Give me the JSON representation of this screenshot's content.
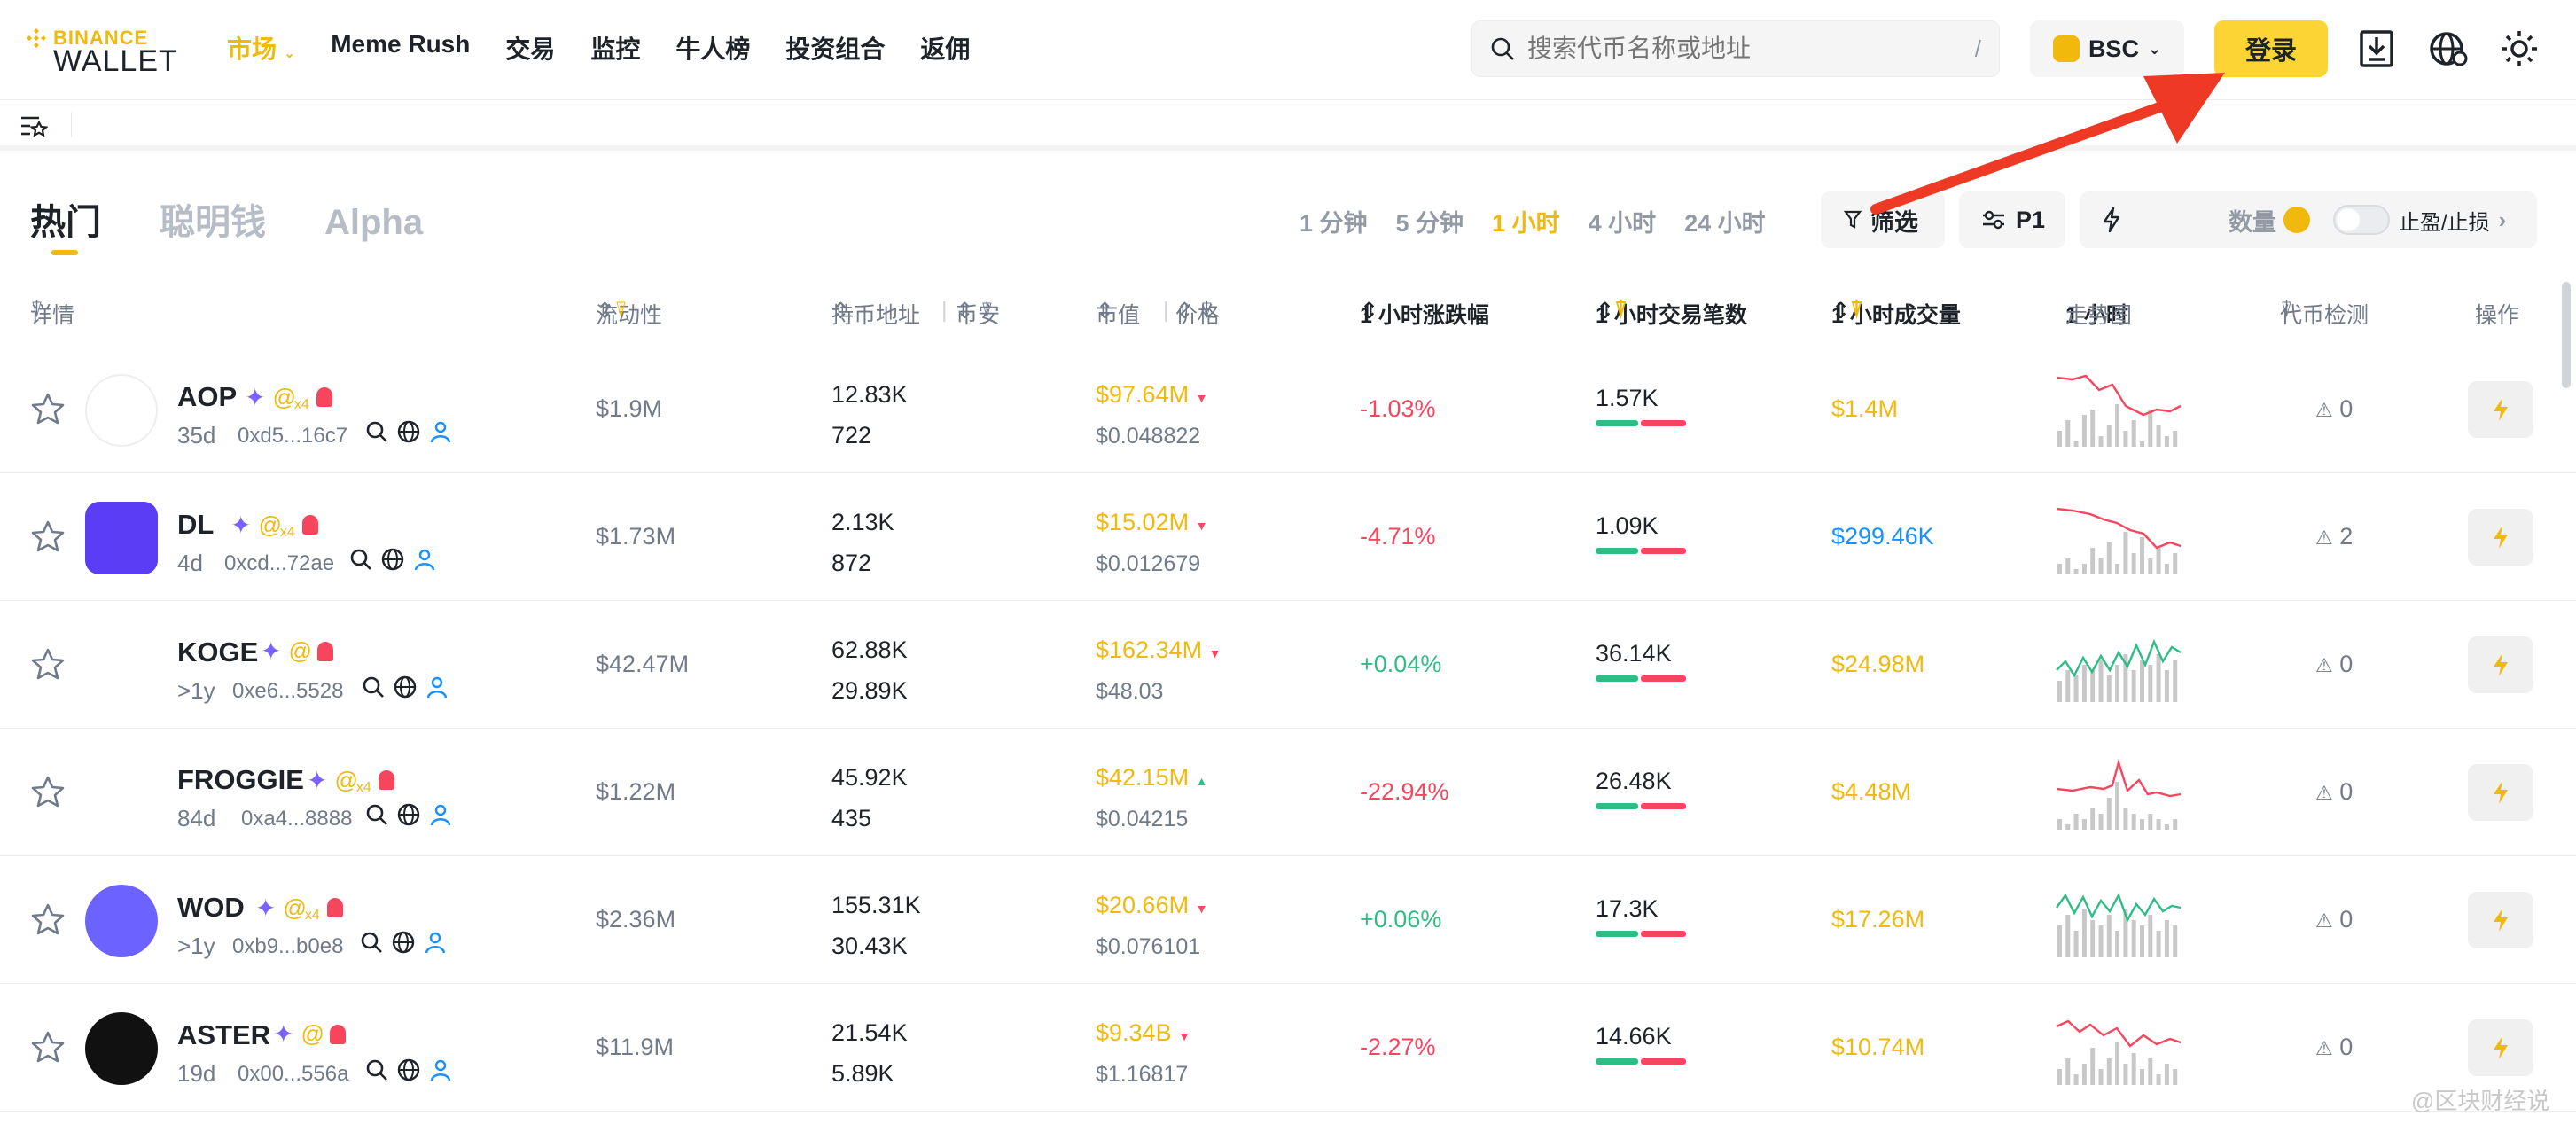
{
  "header": {
    "logo_top": "BINANCE",
    "logo_bottom": "WALLET",
    "nav": [
      "市场",
      "Meme Rush",
      "交易",
      "监控",
      "牛人榜",
      "投资组合",
      "返佣"
    ],
    "search_placeholder": "搜索代币名称或地址",
    "search_shortcut": "/",
    "chain": "BSC",
    "login": "登录"
  },
  "tabs": [
    "热门",
    "聪明钱",
    "Alpha"
  ],
  "time_filters": [
    "1 分钟",
    "5 分钟",
    "1 小时",
    "4 小时",
    "24 小时"
  ],
  "active_time": "1 小时",
  "toolbar": {
    "filter": "筛选",
    "preset": "P1",
    "quantity": "数量",
    "tp_sl": "止盈/止损"
  },
  "columns": {
    "detail": "详情",
    "liquidity": "流动性",
    "holders": "持币地址",
    "binance": "币安",
    "mcap": "市值",
    "price": "价格",
    "change": "1 小时涨跌幅",
    "txns": "1 小时交易笔数",
    "volume": "1 小时成交量",
    "trend_prefix": "1 小时",
    "trend": "走势图",
    "check": "代币检测",
    "action": "操作"
  },
  "rows": [
    {
      "symbol": "AOP",
      "age": "35d",
      "address": "0xd5...16c7",
      "liquidity": "$1.9M",
      "holders": "12.83K",
      "binance_holders": "722",
      "mcap": "$97.64M",
      "price": "$0.048822",
      "change": "-1.03%",
      "txns": "1.57K",
      "volume": "$1.4M",
      "check": "0",
      "badge_count": "x4",
      "trend": "down",
      "change_dir": "down"
    },
    {
      "symbol": "DL",
      "age": "4d",
      "address": "0xcd...72ae",
      "liquidity": "$1.73M",
      "holders": "2.13K",
      "binance_holders": "872",
      "mcap": "$15.02M",
      "price": "$0.012679",
      "change": "-4.71%",
      "txns": "1.09K",
      "volume": "$299.46K",
      "check": "2",
      "badge_count": "x4",
      "trend": "down",
      "change_dir": "down"
    },
    {
      "symbol": "KOGE",
      "age": ">1y",
      "address": "0xe6...5528",
      "liquidity": "$42.47M",
      "holders": "62.88K",
      "binance_holders": "29.89K",
      "mcap": "$162.34M",
      "price": "$48.03",
      "change": "+0.04%",
      "txns": "36.14K",
      "volume": "$24.98M",
      "check": "0",
      "badge_count": "",
      "trend": "flat",
      "change_dir": "down"
    },
    {
      "symbol": "FROGGIE",
      "age": "84d",
      "address": "0xa4...8888",
      "liquidity": "$1.22M",
      "holders": "45.92K",
      "binance_holders": "435",
      "mcap": "$42.15M",
      "price": "$0.04215",
      "change": "-22.94%",
      "txns": "26.48K",
      "volume": "$4.48M",
      "check": "0",
      "badge_count": "x4",
      "trend": "down",
      "change_dir": "up"
    },
    {
      "symbol": "WOD",
      "age": ">1y",
      "address": "0xb9...b0e8",
      "liquidity": "$2.36M",
      "holders": "155.31K",
      "binance_holders": "30.43K",
      "mcap": "$20.66M",
      "price": "$0.076101",
      "change": "+0.06%",
      "txns": "17.3K",
      "volume": "$17.26M",
      "check": "0",
      "badge_count": "x4",
      "trend": "flat",
      "change_dir": "down"
    },
    {
      "symbol": "ASTER",
      "age": "19d",
      "address": "0x00...556a",
      "liquidity": "$11.9M",
      "holders": "21.54K",
      "binance_holders": "5.89K",
      "mcap": "$9.34B",
      "price": "$1.16817",
      "change": "-2.27%",
      "txns": "14.66K",
      "volume": "$10.74M",
      "check": "0",
      "badge_count": "",
      "trend": "down",
      "change_dir": "down"
    }
  ],
  "watermark": "@区块财经说",
  "colors": {
    "brand": "#f0b90b",
    "up": "#2ebd85",
    "down": "#f6465d",
    "link_blue": "#1890ff"
  }
}
